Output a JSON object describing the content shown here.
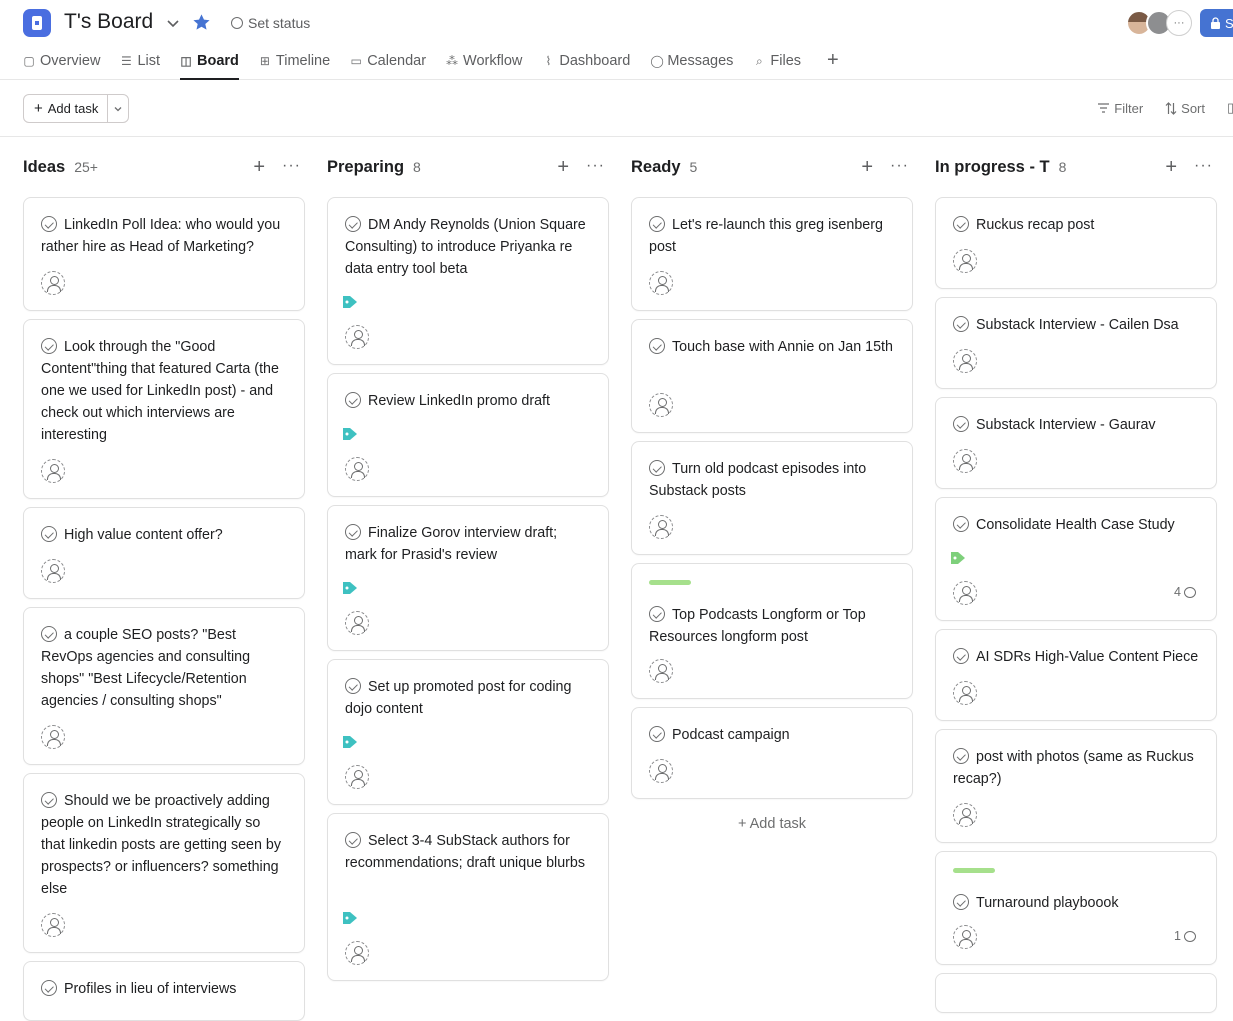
{
  "header": {
    "title": "T's Board",
    "set_status": "Set status",
    "share_label": "S",
    "more_avatars": "···"
  },
  "tabs": [
    {
      "label": "Overview",
      "icon": "overview-icon"
    },
    {
      "label": "List",
      "icon": "list-icon"
    },
    {
      "label": "Board",
      "icon": "board-icon",
      "active": true
    },
    {
      "label": "Timeline",
      "icon": "timeline-icon"
    },
    {
      "label": "Calendar",
      "icon": "calendar-icon"
    },
    {
      "label": "Workflow",
      "icon": "workflow-icon"
    },
    {
      "label": "Dashboard",
      "icon": "dashboard-icon"
    },
    {
      "label": "Messages",
      "icon": "messages-icon"
    },
    {
      "label": "Files",
      "icon": "files-icon"
    }
  ],
  "toolbar": {
    "add_task": "Add task",
    "filter": "Filter",
    "sort": "Sort"
  },
  "colors": {
    "accent": "#4573d2",
    "project_icon": "#4a6ee0",
    "tag": "#3ec1c1",
    "tag_green": "#7ed07b",
    "color_bar": "#a6e08c"
  },
  "columns": [
    {
      "title": "Ideas",
      "count": "25+",
      "cards": [
        {
          "text": "LinkedIn Poll Idea: who would you rather hire as Head of Marketing?"
        },
        {
          "text": "Look through the \"Good Content\"thing that featured Carta (the one we used for LinkedIn post) - and check out which interviews are interesting"
        },
        {
          "text": "High value content offer?"
        },
        {
          "text": "a couple SEO posts? \"Best RevOps agencies and consulting shops\" \"Best Lifecycle/Retention agencies / consulting shops\""
        },
        {
          "text": "Should we be proactively adding people on LinkedIn strategically so that linkedin posts are getting seen by prospects? or influencers? something else"
        },
        {
          "text": "Profiles in lieu of interviews"
        }
      ]
    },
    {
      "title": "Preparing",
      "count": "8",
      "cards": [
        {
          "text": "DM Andy Reynolds (Union Square Consulting) to introduce Priyanka re data entry tool beta"
        },
        {
          "text": "Review LinkedIn promo draft"
        },
        {
          "text": "Finalize Gorov interview draft; mark for Prasid's review"
        },
        {
          "text": "Set up promoted post for coding dojo content"
        },
        {
          "text": "Select 3-4 SubStack authors for recommendations; draft unique blurbs"
        }
      ]
    },
    {
      "title": "Ready",
      "count": "5",
      "cards": [
        {
          "text": "Let's re-launch this greg isenberg post"
        },
        {
          "text": "Touch base with Annie on Jan 15th"
        },
        {
          "text": "Turn old podcast episodes into Substack posts"
        },
        {
          "text": "Top Podcasts Longform or Top Resources longform post"
        },
        {
          "text": "Podcast campaign"
        }
      ],
      "add_task": "+ Add task"
    },
    {
      "title": "In progress - T",
      "count": "8",
      "cards": [
        {
          "text": "Ruckus recap post"
        },
        {
          "text": "Substack Interview - Cailen Dsa"
        },
        {
          "text": "Substack Interview - Gaurav"
        },
        {
          "text": "Consolidate Health Case Study",
          "comments": "4"
        },
        {
          "text": "AI SDRs High-Value Content Piece"
        },
        {
          "text": "post with photos (same as Ruckus recap?)"
        },
        {
          "text": "Turnaround playboook",
          "comments": "1"
        }
      ]
    }
  ]
}
